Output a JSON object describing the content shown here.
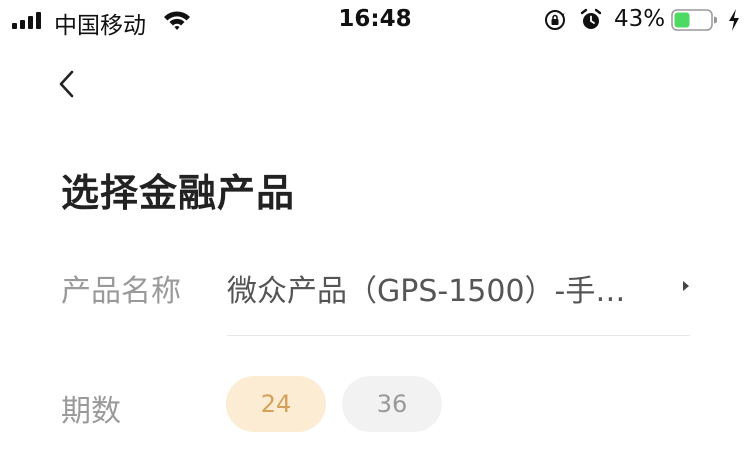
{
  "status_bar": {
    "carrier": "中国移动",
    "time": "16:48",
    "battery_percent": "43%",
    "battery_level": 0.43,
    "icons": [
      "signal-icon",
      "wifi-icon",
      "rotation-lock-icon",
      "alarm-icon",
      "battery-icon",
      "charging-icon"
    ]
  },
  "nav": {
    "back_icon": "chevron-left-icon"
  },
  "page": {
    "title": "选择金融产品"
  },
  "form": {
    "product": {
      "label": "产品名称",
      "value": "微众产品（GPS-1500）-手…",
      "icon": "caret-right-icon"
    },
    "term": {
      "label": "期数",
      "options": [
        {
          "label": "24",
          "selected": true
        },
        {
          "label": "36",
          "selected": false
        }
      ]
    }
  },
  "colors": {
    "selected_chip_bg": "#fbecd3",
    "selected_chip_text": "#d4a05a",
    "chip_bg": "#f2f2f2",
    "chip_text": "#9a9a9a",
    "battery_fill": "#4cd964"
  }
}
